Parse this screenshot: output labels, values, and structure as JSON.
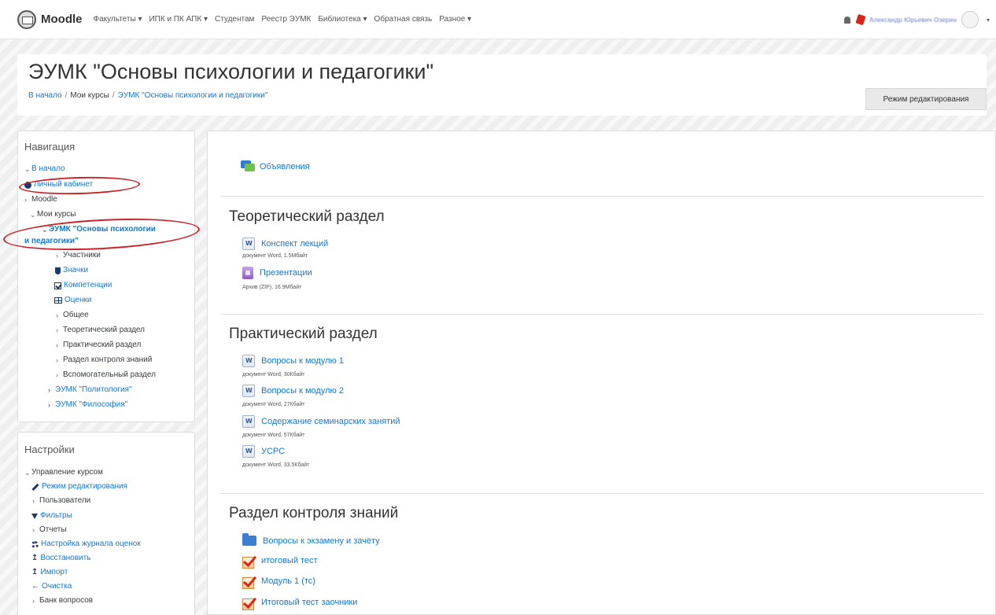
{
  "navbar": {
    "brand": "Moodle",
    "items": [
      "Факультеты ▾",
      "ИПК и ПК АПК ▾",
      "Студентам",
      "Реестр ЭУМК",
      "Библиотека ▾",
      "Обратная связь",
      "Разное ▾"
    ],
    "user_name": "Александр Юрьевич Озерин"
  },
  "header": {
    "title": "ЭУМК \"Основы психологии и педагогики\"",
    "breadcrumb": [
      "В начало",
      "Мои курсы",
      "ЭУМК \"Основы психологии и педагогики\""
    ],
    "edit_button": "Режим редактирования"
  },
  "navigation": {
    "title": "Навигация",
    "home": "В начало",
    "dashboard": "Личный кабинет",
    "moodle": "Moodle",
    "my_courses": "Мои курсы",
    "current_course_line1": "ЭУМК \"Основы психологии",
    "current_course_line2": "и педагогики\"",
    "participants": "Участники",
    "badges": "Значки",
    "competencies": "Компетенции",
    "grades": "Оценки",
    "general": "Общее",
    "theory": "Теоретический раздел",
    "practice": "Практический раздел",
    "control": "Раздел контроля знаний",
    "aux": "Вспомогательный раздел",
    "course2": "ЭУМК \"Политология\"",
    "course3": "ЭУМК \"Философия\""
  },
  "settings": {
    "title": "Настройки",
    "course_admin": "Управление курсом",
    "edit_mode": "Режим редактирования",
    "users": "Пользователи",
    "filters": "Фильтры",
    "reports": "Отчеты",
    "gradebook": "Настройка журнала оценок",
    "restore": "Восстановить",
    "import": "Импорт",
    "reset": "Очистка",
    "question_bank": "Банк вопросов"
  },
  "main": {
    "announcements": "Объявления",
    "sections": {
      "theory": {
        "title": "Теоретический раздел",
        "items": [
          {
            "name": "Конспект лекций",
            "meta": "документ Word, 1.5Мбайт",
            "icon": "word-icon"
          },
          {
            "name": "Презентации",
            "meta": "Архив (ZIP), 16.9Мбайт",
            "icon": "zip-icon"
          }
        ]
      },
      "practice": {
        "title": "Практический раздел",
        "items": [
          {
            "name": "Вопросы к модулю 1",
            "meta": "документ Word, 30Кбайт",
            "icon": "word-icon"
          },
          {
            "name": "Вопросы к модулю 2",
            "meta": "документ Word, 27Кбайт",
            "icon": "word-icon"
          },
          {
            "name": "Содержание семинарских занятий",
            "meta": "документ Word, 57Кбайт",
            "icon": "word-icon"
          },
          {
            "name": "УСРС",
            "meta": "документ Word, 33.5Кбайт",
            "icon": "word-icon"
          }
        ]
      },
      "control": {
        "title": "Раздел контроля знаний",
        "items": [
          {
            "name": "Вопросы к экзамену и зачёту",
            "icon": "folder-icon"
          },
          {
            "name": "итоговый тест",
            "icon": "quiz-icon"
          },
          {
            "name": "Модуль 1 (тс)",
            "icon": "quiz-icon"
          },
          {
            "name": "Итоговый тест заочники",
            "icon": "quiz-icon"
          }
        ]
      }
    }
  },
  "colors": {
    "link": "#1177d1",
    "annotation": "#c6242b"
  }
}
